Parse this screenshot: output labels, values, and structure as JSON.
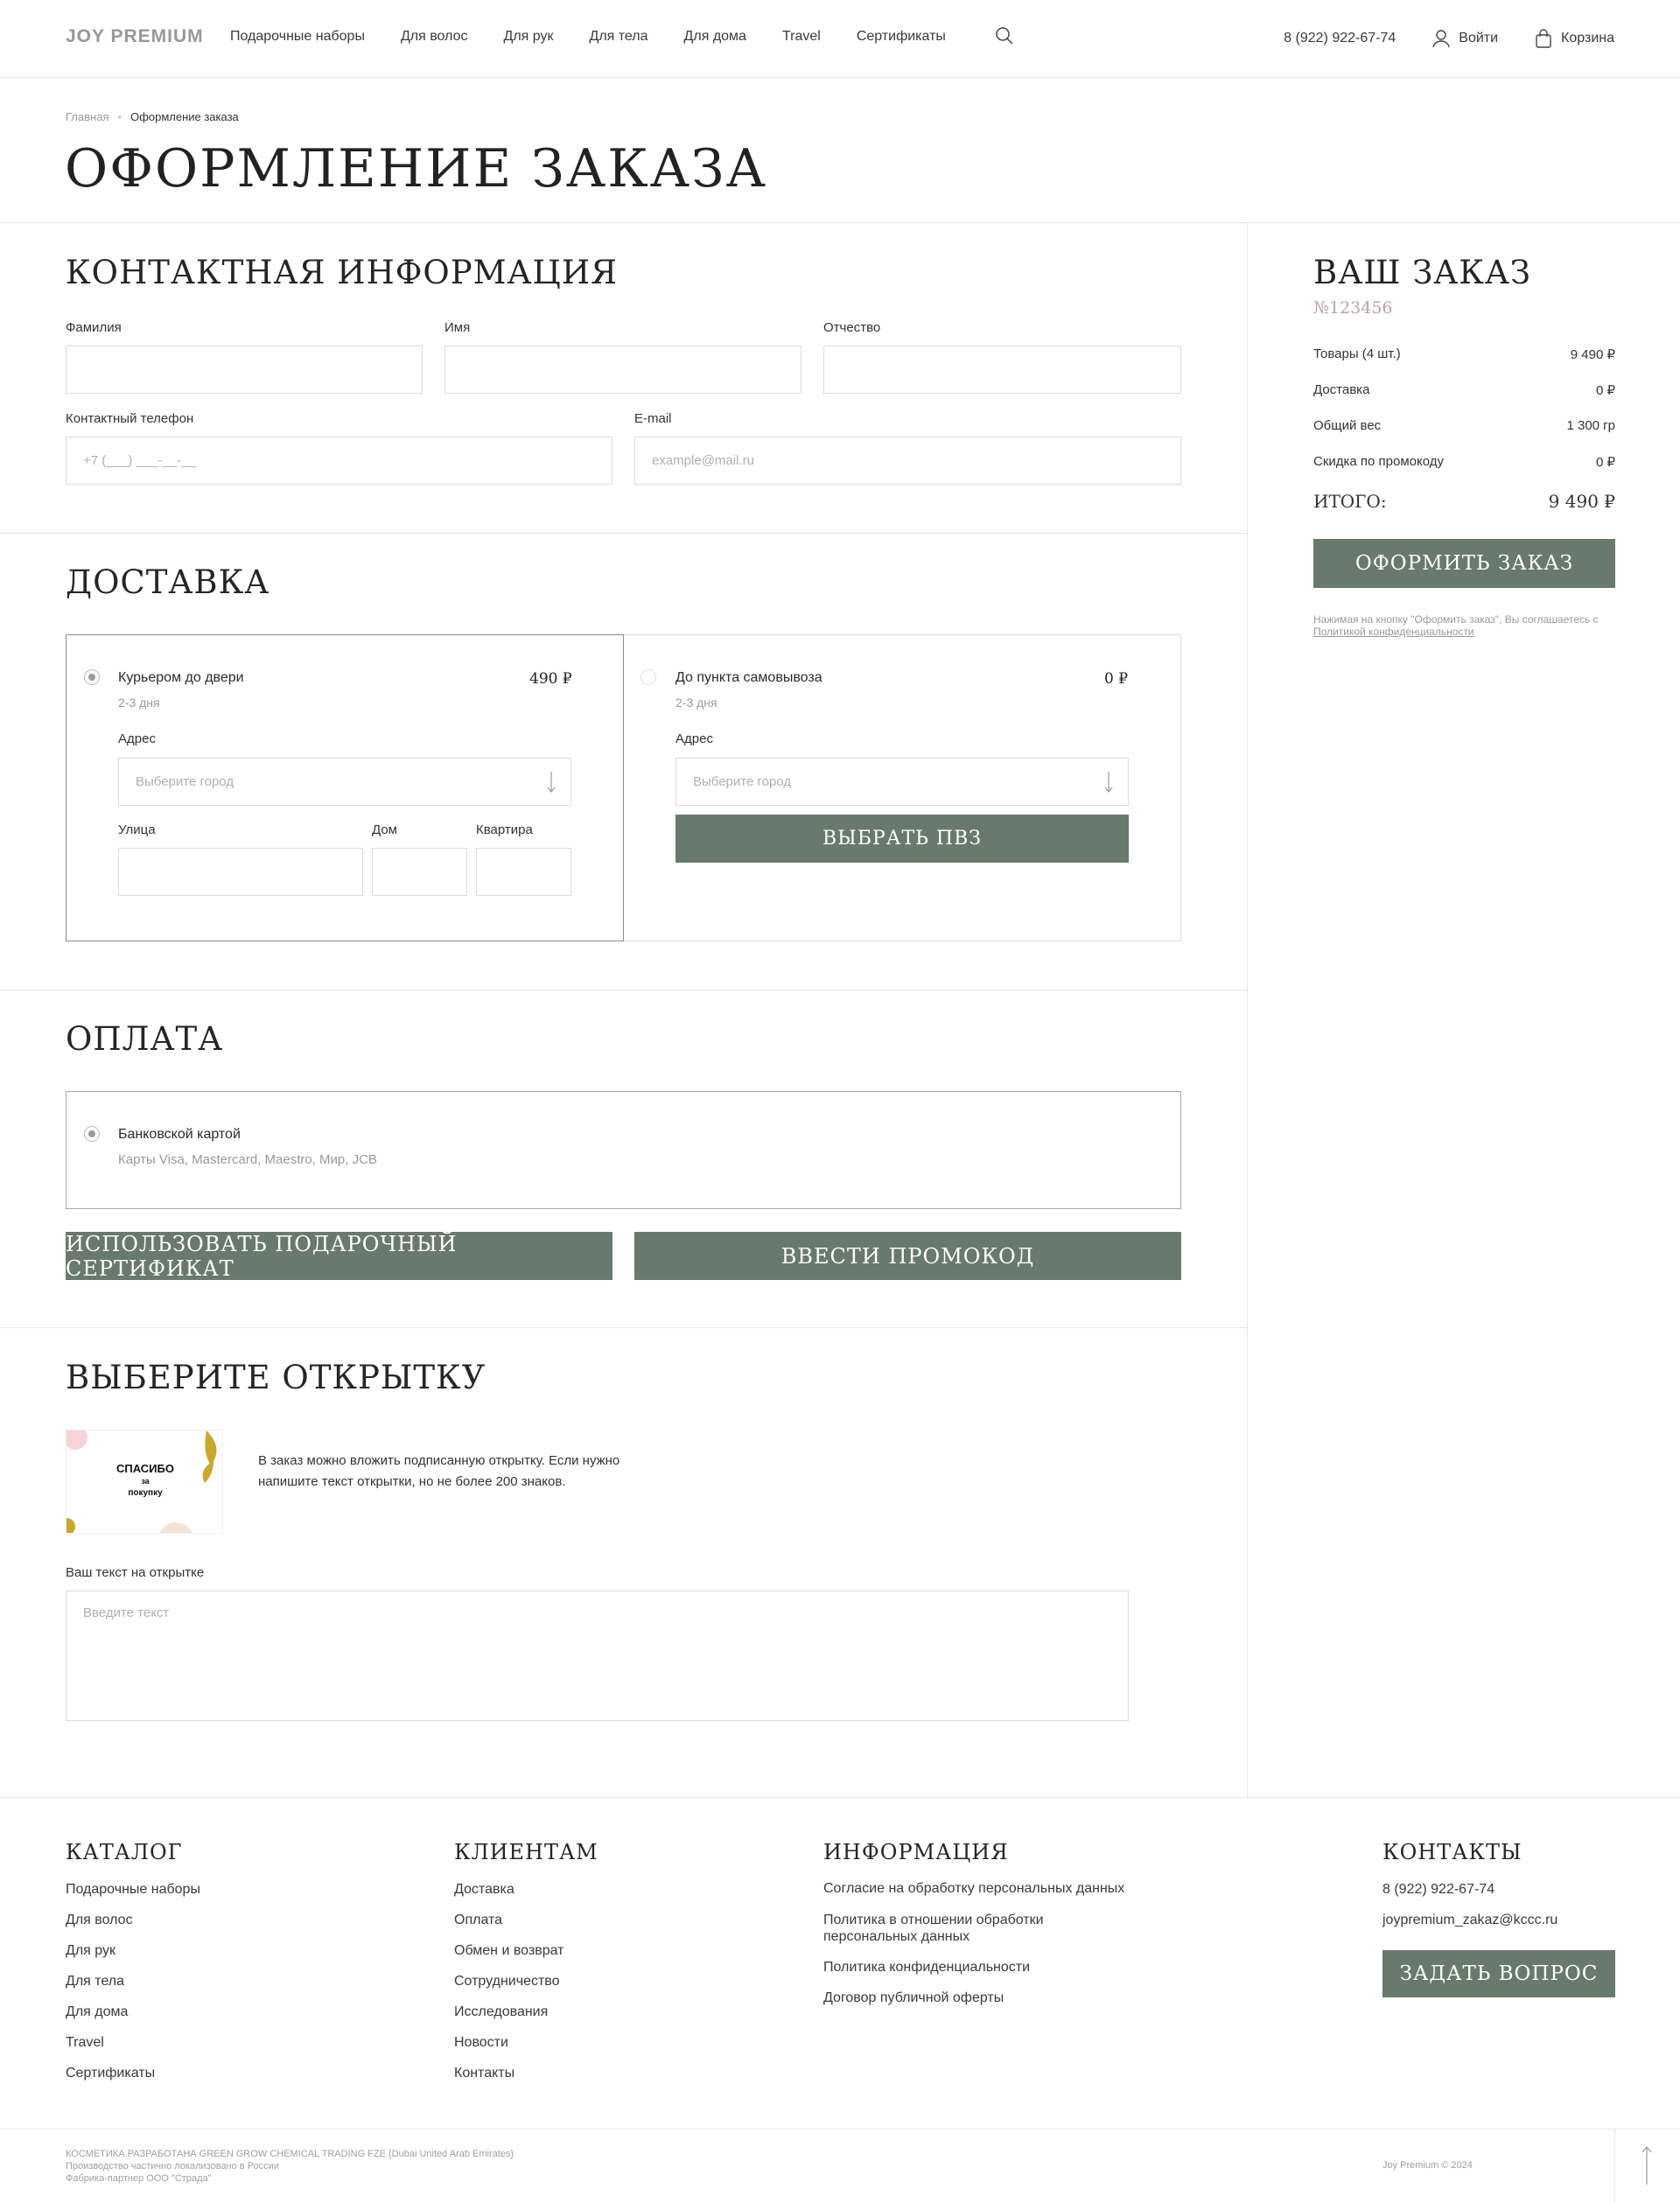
{
  "header": {
    "logo": "JOY PREMIUM",
    "nav": [
      "Подарочные наборы",
      "Для волос",
      "Для рук",
      "Для тела",
      "Для дома",
      "Travel",
      "Сертификаты"
    ],
    "phone": "8 (922) 922-67-74",
    "login": "Войти",
    "cart": "Корзина"
  },
  "breadcrumbs": {
    "home": "Главная",
    "current": "Оформление заказа"
  },
  "page_title": "ОФОРМЛЕНИЕ ЗАКАЗА",
  "contact": {
    "title": "КОНТАКТНАЯ ИНФОРМАЦИЯ",
    "last_name": "Фамилия",
    "first_name": "Имя",
    "middle_name": "Отчество",
    "phone_label": "Контактный телефон",
    "phone_placeholder": "+7 (___) ___-__-__",
    "email_label": "E-mail",
    "email_placeholder": "example@mail.ru"
  },
  "delivery": {
    "title": "ДОСТАВКА",
    "courier": {
      "title": "Курьером до двери",
      "term": "2-3 дня",
      "price": "490 ₽",
      "address": "Адрес",
      "city_placeholder": "Выберите город",
      "street": "Улица",
      "house": "Дом",
      "flat": "Квартира"
    },
    "pickup": {
      "title": "До пункта самовывоза",
      "term": "2-3 дня",
      "price": "0 ₽",
      "address": "Адрес",
      "city_placeholder": "Выберите город",
      "button": "ВЫБРАТЬ ПВЗ"
    }
  },
  "payment": {
    "title": "ОПЛАТА",
    "card_title": "Банковской картой",
    "card_sub": "Карты Visa, Mastercard, Maestro, Мир, JCB",
    "gift_button": "ИСПОЛЬЗОВАТЬ ПОДАРОЧНЫЙ СЕРТИФИКАТ",
    "promo_button": "ВВЕСТИ ПРОМОКОД"
  },
  "postcard": {
    "title": "ВЫБЕРИТЕ ОТКРЫТКУ",
    "card_text_1": "СПАСИБО",
    "card_text_2": "за",
    "card_text_3": "покупку",
    "description": "В заказ можно вложить подписанную открытку. Если нужно напишите текст открытки, но не более 200 знаков.",
    "text_label": "Ваш текст на открытке",
    "text_placeholder": "Введите текст"
  },
  "order": {
    "title": "ВАШ ЗАКАЗ",
    "number": "№123456",
    "rows": [
      {
        "label": "Товары (4 шт.)",
        "value": "9 490 ₽"
      },
      {
        "label": "Доставка",
        "value": "0 ₽"
      },
      {
        "label": "Общий вес",
        "value": "1 300 гр"
      },
      {
        "label": "Скидка по промокоду",
        "value": "0 ₽"
      }
    ],
    "total_label": "ИТОГО:",
    "total_value": "9 490 ₽",
    "submit": "ОФОРМИТЬ ЗАКАЗ",
    "note": "Нажимая на кнопку \"Оформить заказ\", Вы соглашаетесь с",
    "note_link": "Политикой конфиденциальности"
  },
  "footer": {
    "catalog": {
      "title": "КАТАЛОГ",
      "items": [
        "Подарочные наборы",
        "Для волос",
        "Для рук",
        "Для тела",
        "Для дома",
        "Travel",
        "Сертификаты"
      ]
    },
    "clients": {
      "title": "КЛИЕНТАМ",
      "items": [
        "Доставка",
        "Оплата",
        "Обмен и возврат",
        "Сотрудничество",
        "Исследования",
        "Новости",
        "Контакты"
      ]
    },
    "info": {
      "title": "ИНФОРМАЦИЯ",
      "items": [
        "Согласие на обработку персональных данных",
        "Политика в отношении обработки персональных данных",
        "Политика конфиденциальности",
        "Договор публичной оферты"
      ]
    },
    "contacts": {
      "title": "КОНТАКТЫ",
      "phone": "8 (922) 922-67-74",
      "email": "joypremium_zakaz@kccc.ru",
      "button": "ЗАДАТЬ ВОПРОС"
    },
    "legal_1": "КОСМЕТИКА РАЗРАБОТАНА GREEN GROW CHEMICAL TRADING FZE (Dubai United Arab Emirates)",
    "legal_2": "Производство частично локализовано в России",
    "legal_3": "Фабрика-партнер ООО \"Страда\"",
    "copyright": "Joy Premium © 2024"
  },
  "colors": {
    "accent": "#687a6c",
    "logo": "#9c9796",
    "border": "#dcdcdc"
  }
}
